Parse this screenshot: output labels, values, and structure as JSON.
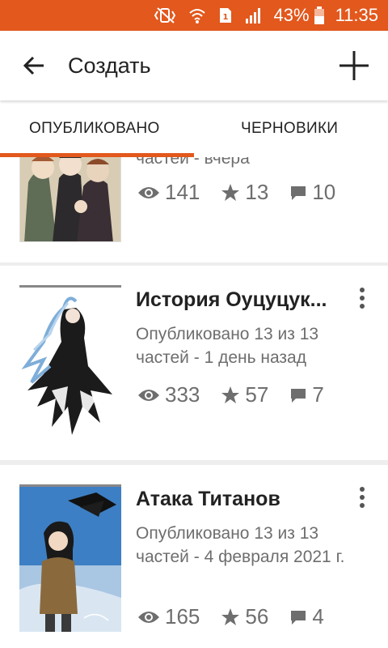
{
  "status_bar": {
    "battery": "43%",
    "time": "11:35"
  },
  "header": {
    "title": "Создать"
  },
  "tabs": [
    {
      "label": "ОПУБЛИКОВАНО"
    },
    {
      "label": "ЧЕРНОВИКИ"
    }
  ],
  "stories": [
    {
      "title": "",
      "status": "частей - вчера",
      "views": "141",
      "votes": "13",
      "comments": "10"
    },
    {
      "title": "История Оуцуцук...",
      "status": "Опубликовано 13 из 13 частей - 1 день назад",
      "views": "333",
      "votes": "57",
      "comments": "7"
    },
    {
      "title": "Атака Титанов",
      "status": "Опубликовано 13 из 13 частей - 4 февраля 2021 г.",
      "views": "165",
      "votes": "56",
      "comments": "4"
    }
  ],
  "colors": {
    "accent": "#e2581d",
    "text": "#222222",
    "muted": "#6e6e6e"
  }
}
